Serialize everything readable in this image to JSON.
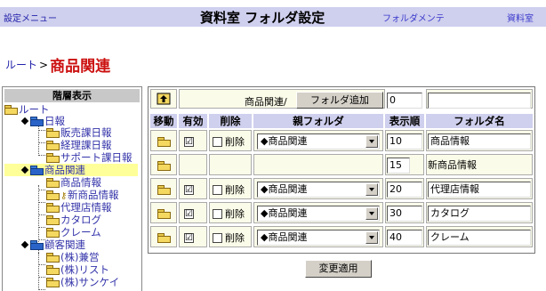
{
  "header": {
    "left_link": "設定メニュー",
    "title": "資料室 フォルダ設定",
    "maint_link": "フォルダメンテ",
    "library_link": "資料室"
  },
  "breadcrumb": {
    "root": "ルート",
    "separator": ">",
    "current": "商品関連"
  },
  "tree": {
    "heading": "階層表示",
    "nodes": [
      {
        "label": "ルート"
      },
      {
        "label": "日報"
      },
      {
        "label": "販売課日報"
      },
      {
        "label": "経理課日報"
      },
      {
        "label": "サポート課日報"
      },
      {
        "label": "商品関連"
      },
      {
        "label": "商品情報"
      },
      {
        "label": "新商品情報"
      },
      {
        "label": "代理店情報"
      },
      {
        "label": "カタログ"
      },
      {
        "label": "クレーム"
      },
      {
        "label": "顧客関連"
      },
      {
        "label": "(株)兼営"
      },
      {
        "label": "(株)リスト"
      },
      {
        "label": "(株)サンケイ"
      }
    ]
  },
  "table": {
    "top_path": "商品関連/",
    "add_button": "フォルダ追加",
    "add_order_value": "0",
    "add_name_value": "",
    "headers": {
      "move": "移動",
      "valid": "有効",
      "delete": "削除",
      "parent": "親フォルダ",
      "order": "表示順",
      "name": "フォルダ名"
    },
    "delete_label": "削除",
    "rows": [
      {
        "valid": "☑",
        "parent": "◆商品関連",
        "order": "10",
        "name": "商品情報"
      },
      {
        "order": "15",
        "name": "新商品情報"
      },
      {
        "valid": "☑",
        "parent": "◆商品関連",
        "order": "20",
        "name": "代理店情報"
      },
      {
        "valid": "☑",
        "parent": "◆商品関連",
        "order": "30",
        "name": "カタログ"
      },
      {
        "valid": "☑",
        "parent": "◆商品関連",
        "order": "40",
        "name": "クレーム"
      }
    ],
    "apply_button": "変更適用"
  }
}
